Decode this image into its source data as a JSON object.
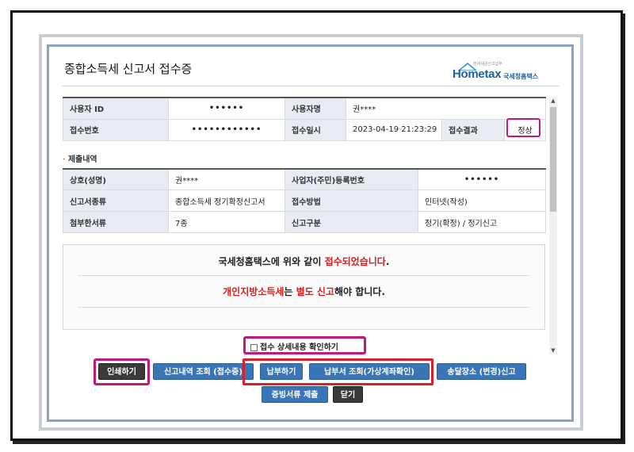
{
  "window": {
    "title": "종합소득세 신고서 접수증",
    "logo": {
      "text": "Hometax",
      "korean": "국세청홈택스",
      "small": "전자세금신고납부"
    }
  },
  "receipt": {
    "user_id_label": "사용자 ID",
    "user_id_value": "••••••",
    "user_name_label": "사용자명",
    "user_name_value": "권****",
    "receipt_no_label": "접수번호",
    "receipt_no_value": "••••••••••••",
    "receipt_date_label": "접수일시",
    "receipt_date_value": "2023-04-19 21:23:29",
    "result_label": "접수결과",
    "result_value": "정상"
  },
  "submission": {
    "section_title": "제출내역",
    "company_label": "상호(성명)",
    "company_value": "권****",
    "reg_no_label": "사업자(주민)등록번호",
    "reg_no_value": "••••••",
    "report_type_label": "신고서종류",
    "report_type_value": "종합소득세 정기확정신고서",
    "method_label": "접수방법",
    "method_value": "인터넷(작성)",
    "attach_label": "첨부한서류",
    "attach_value": "7종",
    "category_label": "신고구분",
    "category_value": "정기(확정) / 정기신고"
  },
  "message": {
    "line1_pre": "국세청홈택스에 위와 같이 ",
    "line1_red": "접수되었습니다",
    "line1_post": ".",
    "line2_red1": "개인지방소득세",
    "line2_mid": "는 ",
    "line2_red2": "별도 신고",
    "line2_post": "해야 합니다."
  },
  "checkbox": {
    "label": "접수 상세내용 확인하기",
    "checked": false
  },
  "buttons": {
    "print": "인쇄하기",
    "history": "신고내역 조회 (접수증)",
    "pay": "납부하기",
    "pay_inquiry": "납부서 조회(가상계좌확인)",
    "address": "송달장소 (변경)신고",
    "evidence": "증빙서류 제출",
    "close": "닫기"
  },
  "colors": {
    "accent_blue": "#3a75b8",
    "highlight_pink": "#c2187a",
    "highlight_red": "#d81f2a",
    "text_red": "#d81f1f"
  }
}
